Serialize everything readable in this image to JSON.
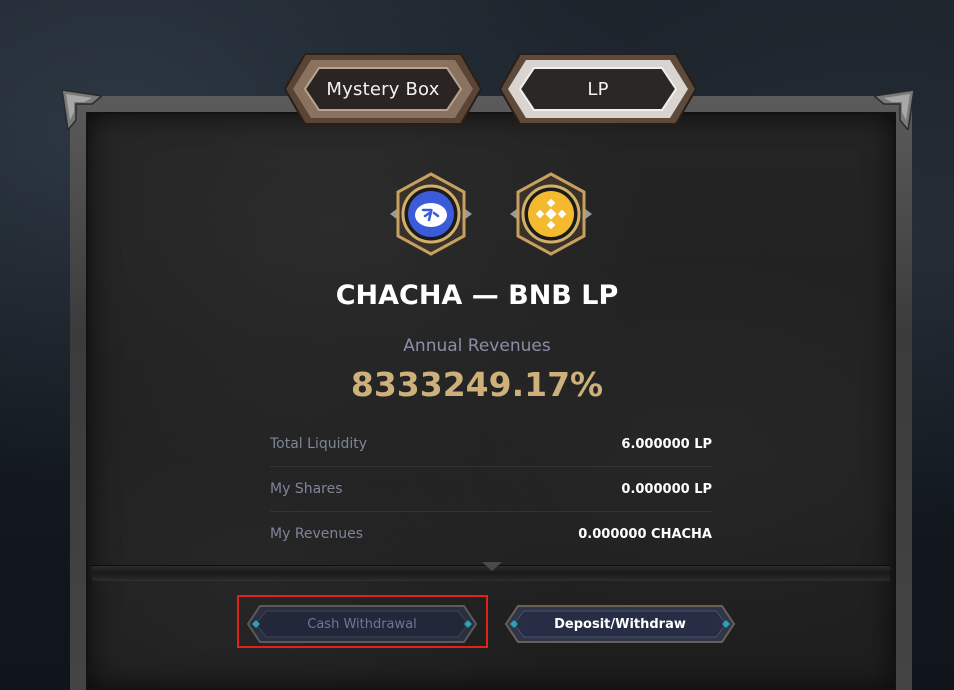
{
  "tabs": [
    {
      "label": "Mystery Box",
      "active": false
    },
    {
      "label": "LP",
      "active": true
    }
  ],
  "pool": {
    "title": "CHACHA — BNB LP",
    "token_a_icon": "chacha-token-icon",
    "token_b_icon": "bnb-token-icon"
  },
  "annual": {
    "label": "Annual Revenues",
    "value": "8333249.17%"
  },
  "stats": [
    {
      "label": "Total Liquidity",
      "value": "6.000000 LP"
    },
    {
      "label": "My Shares",
      "value": "0.000000 LP"
    },
    {
      "label": "My Revenues",
      "value": "0.000000 CHACHA"
    }
  ],
  "buttons": {
    "cash_withdrawal": "Cash Withdrawal",
    "deposit_withdraw": "Deposit/Withdraw"
  },
  "colors": {
    "accent_gold": "#cdb07a",
    "highlight": "#e0221d",
    "muted_label": "#7f8599",
    "bnb_yellow": "#f3ba2f",
    "chacha_blue": "#3b5bd8"
  }
}
